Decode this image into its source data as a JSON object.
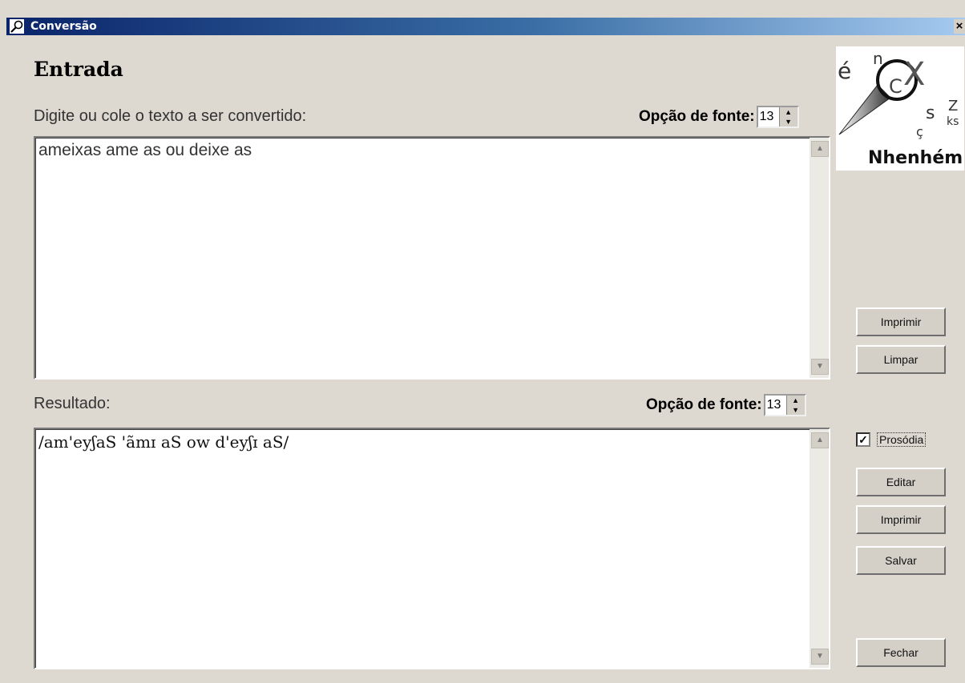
{
  "window": {
    "title": "Conversão",
    "close_symbol": "×",
    "icon": "app-icon"
  },
  "input_section": {
    "heading": "Entrada",
    "prompt": "Digite ou cole o texto a ser convertido:",
    "font_option_label": "Opção de fonte:",
    "font_size": "13",
    "text": "ameixas ame as ou deixe as"
  },
  "result_section": {
    "label": "Resultado:",
    "font_option_label": "Opção de fonte:",
    "font_size": "13",
    "text": "/am'eyʃaS 'ãmɪ aS ow d'eyʃɪ aS/"
  },
  "buttons": {
    "print_input": "Imprimir",
    "clear": "Limpar",
    "prosody_label": "Prosódia",
    "prosody_checked": true,
    "edit": "Editar",
    "print_result": "Imprimir",
    "save": "Salvar",
    "close": "Fechar"
  },
  "logo": {
    "name": "Nhenhém",
    "letters": [
      "é",
      "n",
      "C",
      "X",
      "Z",
      "ks",
      "s",
      "ç"
    ]
  },
  "colors": {
    "titlebar_start": "#0a246a",
    "titlebar_end": "#a6caf0",
    "window_bg": "#ddd8d0"
  }
}
